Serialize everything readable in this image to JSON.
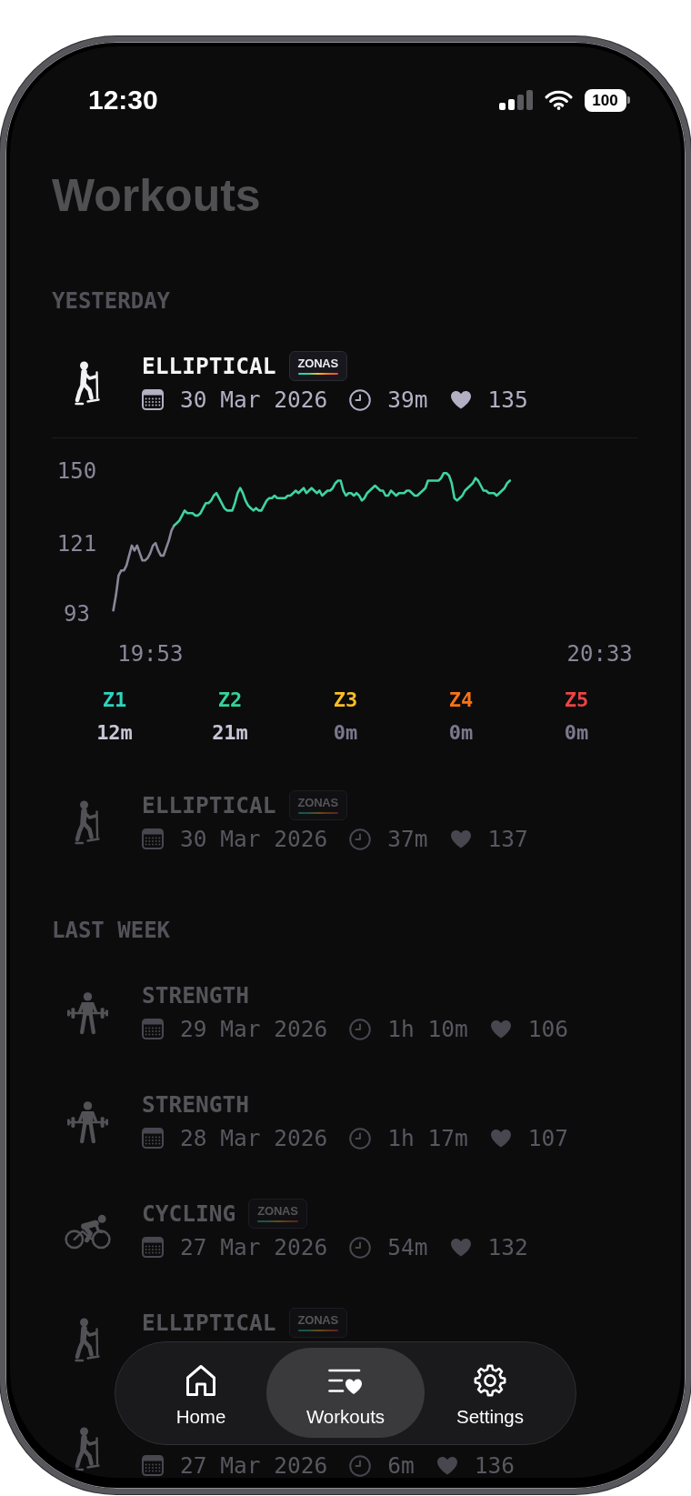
{
  "status_bar": {
    "time": "12:30",
    "battery": "100"
  },
  "title": "Workouts",
  "sections": [
    {
      "heading": "YESTERDAY",
      "workouts": [
        {
          "kind": "elliptical",
          "title": "ELLIPTICAL",
          "badge": "ZONAS",
          "date": "30 Mar 2026",
          "duration": "39m",
          "heart_rate": "135",
          "expanded": true,
          "chart_data": {
            "type": "line",
            "categories": [
              null,
              null,
              null,
              null,
              null,
              null,
              null,
              null,
              null,
              null,
              null,
              null,
              null,
              null,
              "19:53",
              null,
              null,
              null,
              null,
              null,
              null,
              null,
              null,
              null,
              null,
              null,
              null,
              null,
              null,
              null,
              null,
              null,
              null,
              null,
              null,
              null,
              null,
              null,
              null,
              null,
              null,
              null,
              null,
              null,
              null,
              null,
              null,
              null,
              null,
              null,
              null,
              null,
              null,
              null,
              null,
              null,
              null,
              null,
              null,
              null,
              null,
              null,
              null,
              null,
              null,
              null,
              null,
              null,
              null,
              null,
              null,
              null,
              null,
              null,
              null,
              null,
              null,
              null,
              null,
              null,
              null,
              null,
              null,
              null,
              null,
              null,
              null,
              null,
              null,
              null,
              null,
              null,
              null,
              null,
              null,
              null,
              null,
              null,
              null,
              null,
              null,
              null,
              null,
              null,
              null,
              null,
              null,
              null,
              null,
              null,
              null,
              null,
              null,
              null,
              null,
              null,
              null,
              null,
              null,
              null,
              null,
              null,
              null,
              null,
              null,
              null,
              null,
              null,
              null,
              null,
              null,
              null,
              null,
              null,
              null,
              null,
              null,
              null,
              null,
              null,
              null,
              null,
              null,
              null,
              null,
              null,
              null,
              null,
              null,
              null,
              null,
              null,
              null,
              null,
              null,
              null,
              null,
              null,
              null,
              null,
              null,
              null,
              null,
              null,
              null,
              null,
              null,
              null,
              null,
              null,
              null,
              null,
              null,
              null,
              null,
              null,
              null,
              null,
              null,
              null,
              null,
              null,
              null,
              null,
              "20:33"
            ],
            "series": [
              {
                "color": "#8a8799",
                "values": [
                  94,
                  100,
                  108,
                  110,
                  110,
                  112,
                  116,
                  120,
                  118,
                  120,
                  117,
                  114,
                  114,
                  115,
                  117,
                  120,
                  121,
                  118,
                  116,
                  116,
                  119,
                  122,
                  126,
                  128,
                  null,
                  null,
                  null,
                  null,
                  null,
                  null,
                  null,
                  null,
                  null,
                  null,
                  null,
                  null,
                  null,
                  null,
                  null,
                  null,
                  null,
                  null,
                  null,
                  null,
                  null,
                  null,
                  null,
                  null,
                  null,
                  null,
                  null,
                  null,
                  null,
                  null,
                  null,
                  null,
                  null,
                  null,
                  null,
                  null,
                  null,
                  null,
                  null,
                  null,
                  null,
                  null,
                  null,
                  null,
                  null,
                  null,
                  null,
                  null,
                  null,
                  null,
                  null,
                  null,
                  null,
                  null,
                  null,
                  null,
                  null,
                  null,
                  null,
                  null,
                  null,
                  null,
                  null,
                  null,
                  null,
                  null,
                  null,
                  null,
                  null,
                  null,
                  null,
                  null,
                  null,
                  null,
                  null,
                  null,
                  null,
                  null,
                  null,
                  null,
                  null,
                  null,
                  null,
                  null,
                  null,
                  null,
                  null,
                  null,
                  null,
                  null,
                  null,
                  null,
                  null,
                  null,
                  null,
                  null,
                  null,
                  null,
                  null,
                  null,
                  null,
                  null,
                  null,
                  null,
                  null,
                  null,
                  null,
                  null,
                  null,
                  null,
                  null,
                  null,
                  null,
                  null,
                  null,
                  null,
                  null,
                  null,
                  null,
                  null,
                  null,
                  null,
                  null,
                  null,
                  null,
                  null,
                  null,
                  null,
                  null,
                  null,
                  null,
                  null,
                  null,
                  null,
                  null,
                  null,
                  null,
                  null,
                  null,
                  null,
                  null,
                  null,
                  null,
                  null,
                  null,
                  null,
                  null,
                  null,
                  null,
                  null,
                  null,
                  null,
                  null,
                  null,
                  null,
                  null,
                  null,
                  null,
                  null,
                  null,
                  null
                ]
              },
              {
                "color": "#3fd4a0",
                "values": [
                  null,
                  null,
                  null,
                  null,
                  null,
                  null,
                  null,
                  null,
                  null,
                  null,
                  null,
                  null,
                  null,
                  null,
                  null,
                  null,
                  null,
                  null,
                  null,
                  null,
                  null,
                  null,
                  null,
                  128,
                  129,
                  130,
                  132,
                  134,
                  133,
                  133,
                  133,
                  132,
                  132,
                  133,
                  135,
                  137,
                  137,
                  138,
                  140,
                  141,
                  139,
                  137,
                  135,
                  134,
                  134,
                  134,
                  137,
                  141,
                  143,
                  141,
                  138,
                  136,
                  135,
                  134,
                  135,
                  134,
                  134,
                  136,
                  138,
                  139,
                  139,
                  140,
                  139,
                  139,
                  139,
                  139,
                  140,
                  140,
                  141,
                  142,
                  141,
                  142,
                  143,
                  141,
                  142,
                  143,
                  142,
                  141,
                  142,
                  140,
                  141,
                  142,
                  142,
                  143,
                  145,
                  146,
                  146,
                  142,
                  140,
                  141,
                  141,
                  140,
                  141,
                  140,
                  138,
                  139,
                  141,
                  142,
                  143,
                  144,
                  143,
                  142,
                  142,
                  140,
                  140,
                  142,
                  141,
                  140,
                  141,
                  141,
                  141,
                  142,
                  142,
                  141,
                  140,
                  140,
                  141,
                  142,
                  143,
                  146,
                  146,
                  146,
                  146,
                  146,
                  147,
                  149,
                  149,
                  148,
                  145,
                  139,
                  138,
                  139,
                  140,
                  142,
                  143,
                  144,
                  145,
                  147,
                  146,
                  144,
                  142,
                  142,
                  141,
                  141,
                  141,
                  140,
                  141,
                  142,
                  143,
                  145,
                  146,
                  null,
                  null,
                  null,
                  null,
                  null,
                  null,
                  null,
                  null,
                  null,
                  null,
                  null,
                  null,
                  null,
                  null,
                  null,
                  null,
                  null,
                  null,
                  null,
                  null,
                  null,
                  null,
                  null,
                  null,
                  null,
                  null,
                  null,
                  null,
                  null,
                  null,
                  null,
                  null,
                  null,
                  null
                ]
              }
            ],
            "ylim": [
              93,
              150
            ],
            "yticks": [
              150,
              121,
              93
            ]
          },
          "zones": [
            {
              "label": "Z1",
              "value": "12m",
              "color": "#2dd4bf",
              "muted": false
            },
            {
              "label": "Z2",
              "value": "21m",
              "color": "#34d399",
              "muted": false
            },
            {
              "label": "Z3",
              "value": "0m",
              "color": "#fbbf24",
              "muted": true
            },
            {
              "label": "Z4",
              "value": "0m",
              "color": "#f97316",
              "muted": true
            },
            {
              "label": "Z5",
              "value": "0m",
              "color": "#ef4444",
              "muted": true
            }
          ]
        },
        {
          "kind": "elliptical",
          "title": "ELLIPTICAL",
          "badge": "ZONAS",
          "date": "30 Mar 2026",
          "duration": "37m",
          "heart_rate": "137",
          "expanded": false
        }
      ]
    },
    {
      "heading": "LAST WEEK",
      "workouts": [
        {
          "kind": "strength",
          "title": "STRENGTH",
          "date": "29 Mar 2026",
          "duration": "1h 10m",
          "heart_rate": "106",
          "expanded": false
        },
        {
          "kind": "strength",
          "title": "STRENGTH",
          "date": "28 Mar 2026",
          "duration": "1h 17m",
          "heart_rate": "107",
          "expanded": false
        },
        {
          "kind": "cycling",
          "title": "CYCLING",
          "badge": "ZONAS",
          "date": "27 Mar 2026",
          "duration": "54m",
          "heart_rate": "132",
          "expanded": false
        },
        {
          "kind": "elliptical",
          "title": "ELLIPTICAL",
          "badge": "ZONAS",
          "expanded": false
        },
        {
          "kind": "elliptical",
          "date": "27 Mar 2026",
          "duration": "6m",
          "heart_rate": "136",
          "expanded": false
        }
      ]
    }
  ],
  "tab_bar": [
    {
      "kind": "home",
      "label": "Home",
      "selected": false
    },
    {
      "kind": "workouts",
      "label": "Workouts",
      "selected": true
    },
    {
      "kind": "settings",
      "label": "Settings",
      "selected": false
    }
  ]
}
